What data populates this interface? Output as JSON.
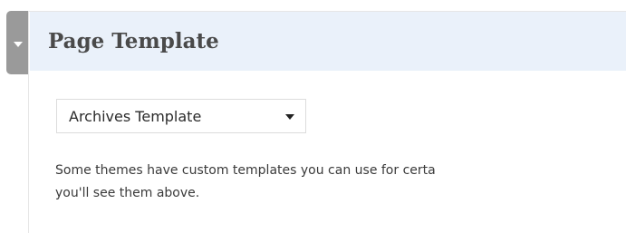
{
  "panel": {
    "title": "Page Template",
    "toggle_icon": "chevron-down-icon"
  },
  "template_select": {
    "selected": "Archives Template",
    "caret_icon": "caret-down-icon"
  },
  "help_text": {
    "line1": "Some themes have custom templates you can use for certa",
    "line2": "you'll see them above."
  },
  "colors": {
    "header_bg": "#eaf1fa",
    "toggle_tab": "#9a9a9a",
    "title_text": "#4a4a4a"
  }
}
